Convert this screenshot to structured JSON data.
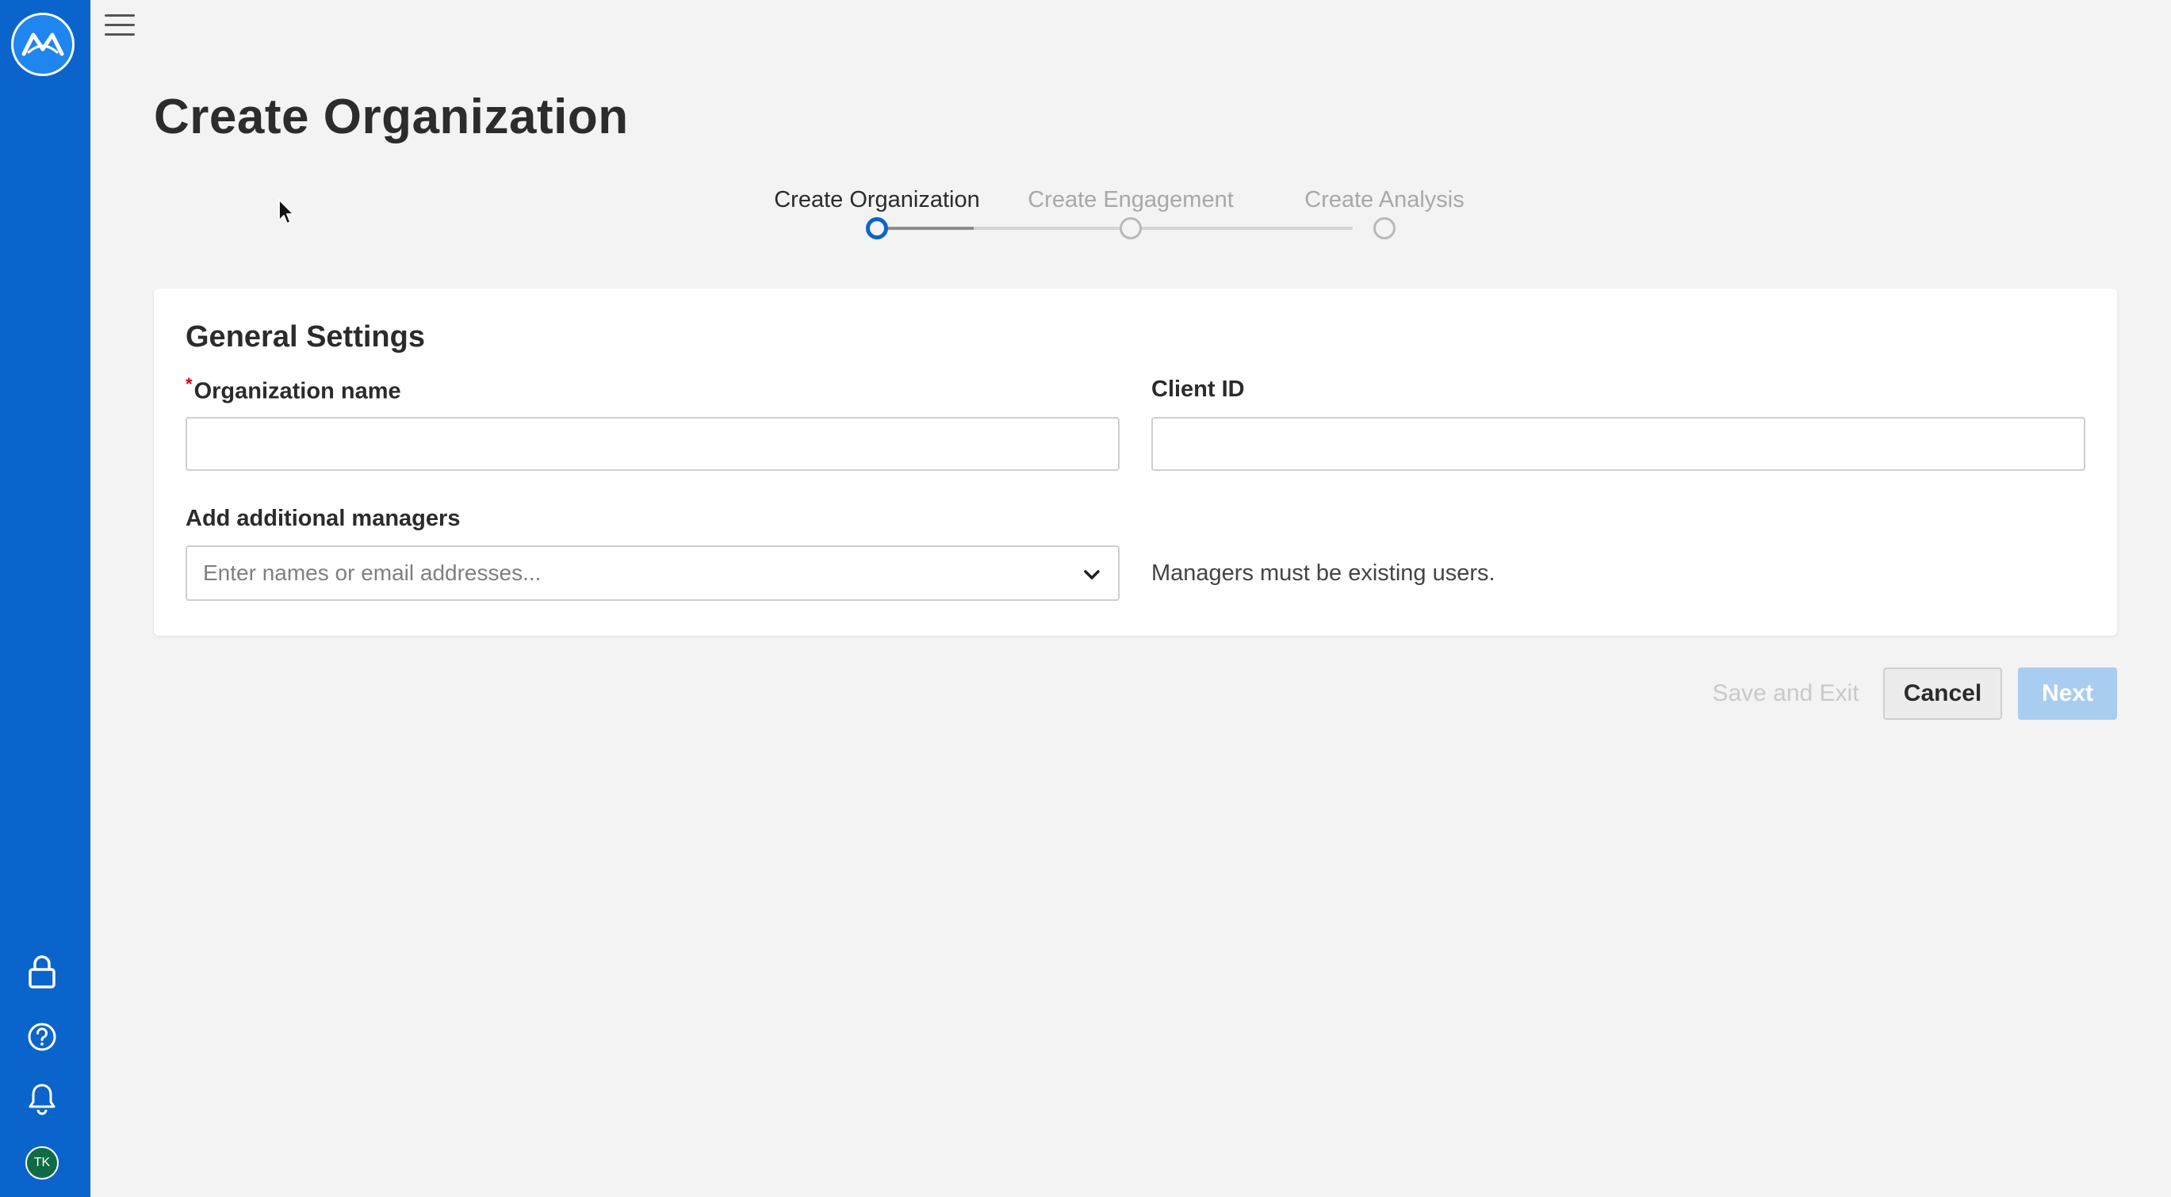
{
  "page": {
    "title": "Create Organization"
  },
  "sidebar": {
    "logo_icon": "logo-icon",
    "bottom_icons": [
      "lock-icon",
      "help-icon",
      "bell-icon"
    ],
    "avatar_initials": "TK",
    "accent_color": "#0a64cc"
  },
  "stepper": {
    "steps": [
      {
        "label": "Create Organization",
        "state": "active"
      },
      {
        "label": "Create Engagement",
        "state": "inactive"
      },
      {
        "label": "Create Analysis",
        "state": "inactive"
      }
    ]
  },
  "form": {
    "section_title": "General Settings",
    "required_marker": "*",
    "org_name": {
      "label": "Organization name",
      "value": ""
    },
    "client_id": {
      "label": "Client ID",
      "value": ""
    },
    "managers": {
      "label": "Add additional managers",
      "placeholder": "Enter names or email addresses...",
      "hint": "Managers must be existing users."
    }
  },
  "actions": {
    "save_exit": "Save and Exit",
    "cancel": "Cancel",
    "next": "Next"
  }
}
